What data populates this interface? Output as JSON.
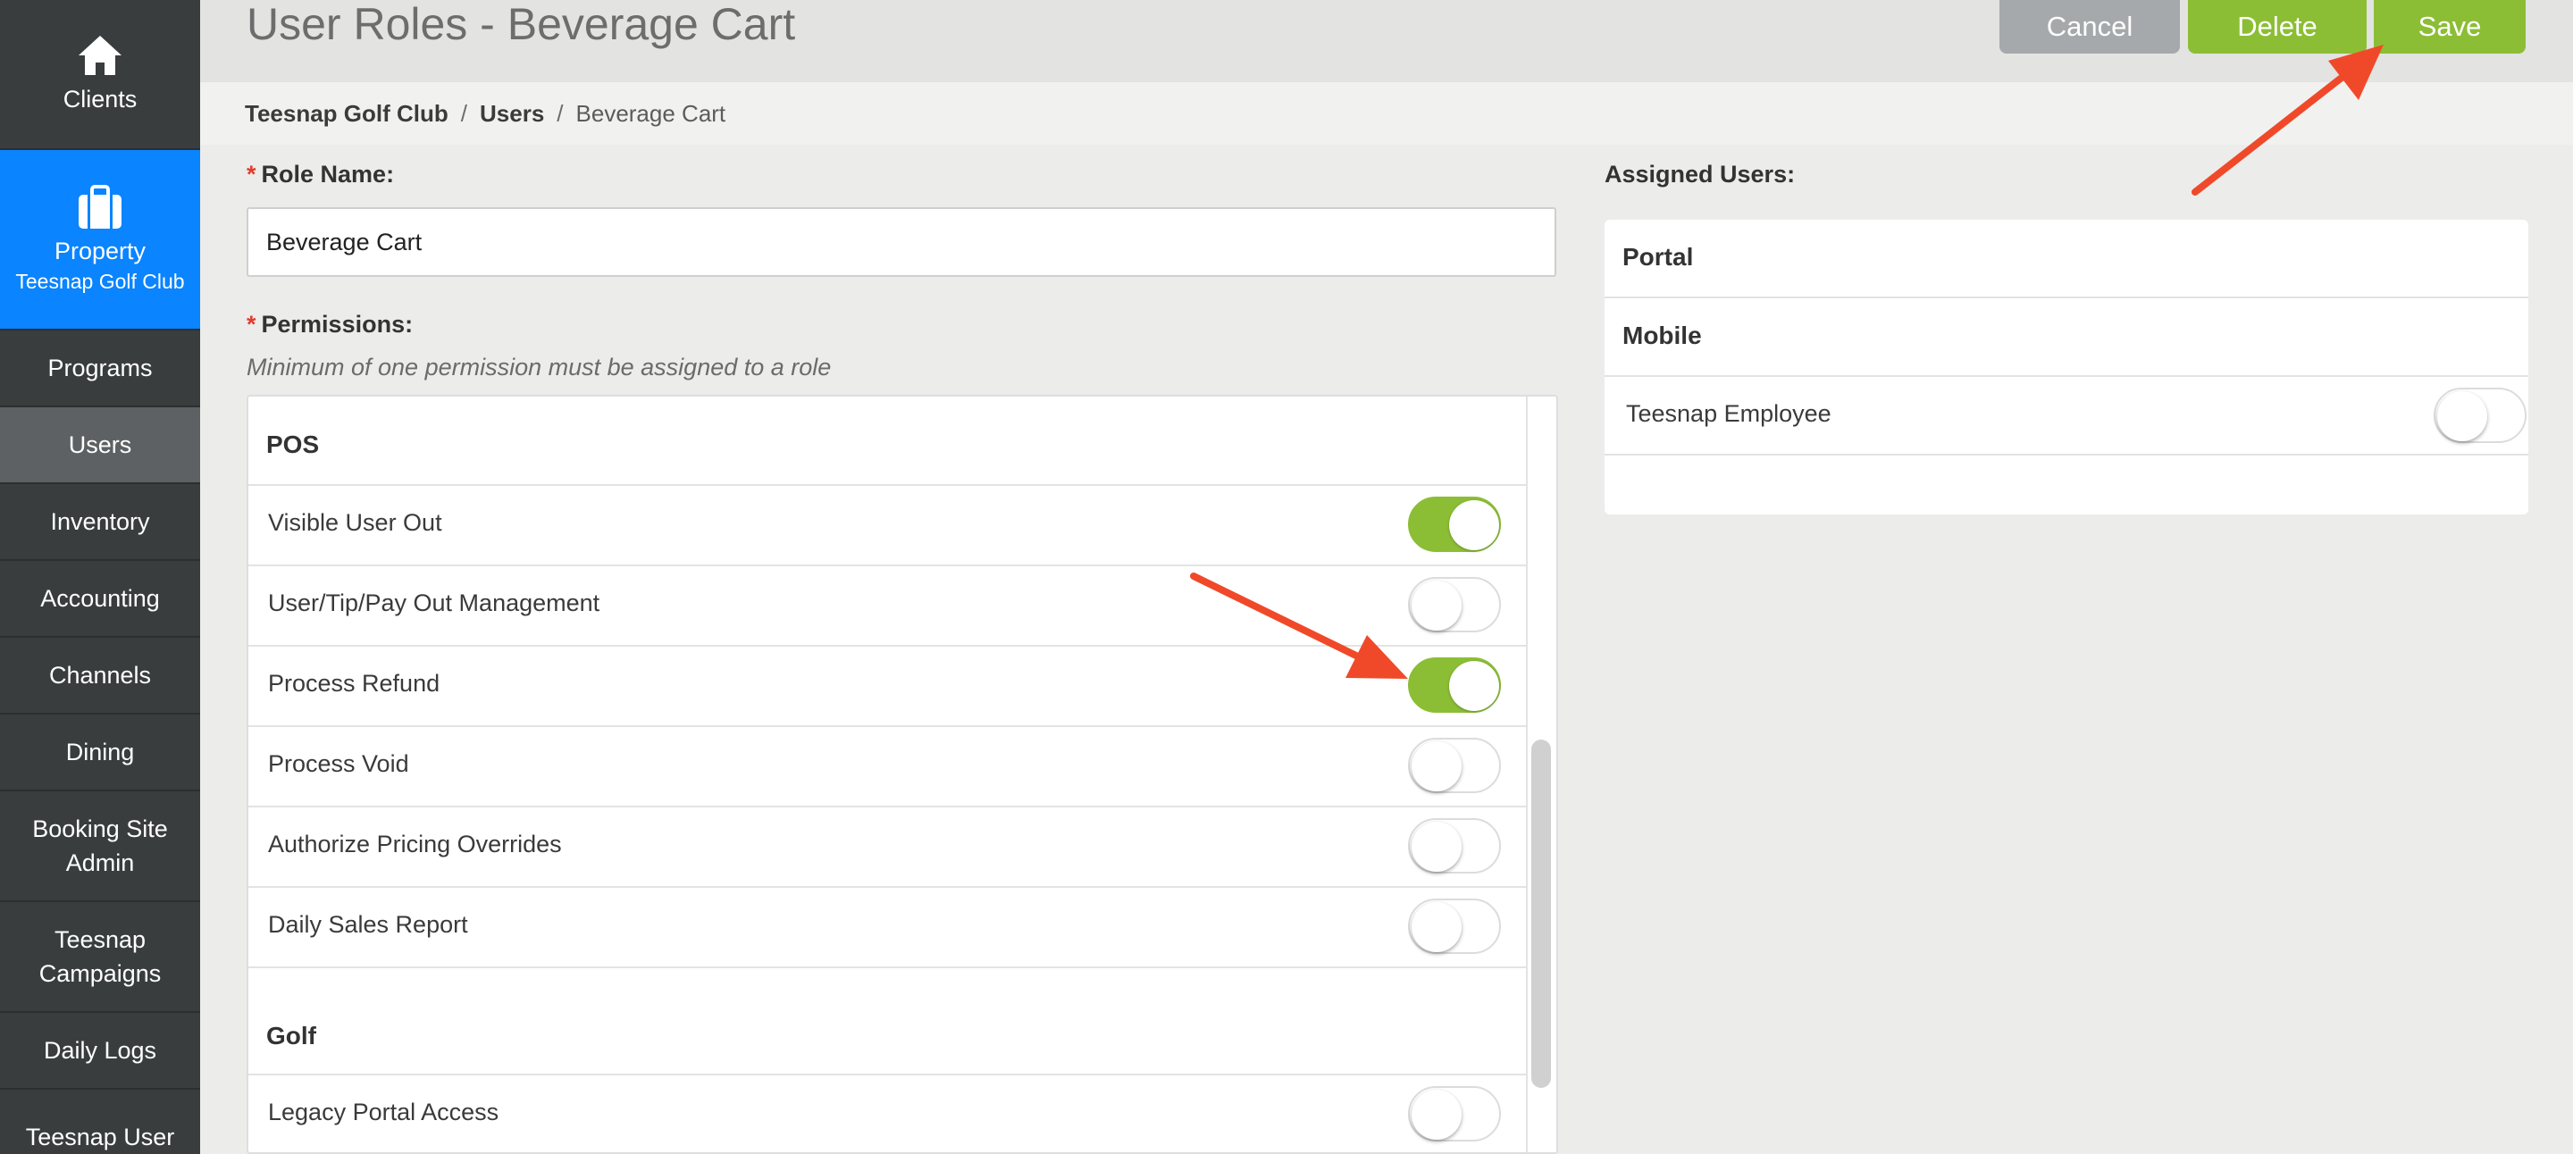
{
  "sidebar": {
    "items": [
      {
        "label": "Clients",
        "icon": "home-icon"
      },
      {
        "label": "Property",
        "sub": "Teesnap Golf Club",
        "icon": "briefcase-icon"
      },
      {
        "label": "Programs"
      },
      {
        "label": "Users"
      },
      {
        "label": "Inventory"
      },
      {
        "label": "Accounting"
      },
      {
        "label": "Channels"
      },
      {
        "label": "Dining"
      },
      {
        "label": "Booking Site",
        "label2": "Admin"
      },
      {
        "label": "Teesnap",
        "label2": "Campaigns"
      },
      {
        "label": "Daily Logs"
      },
      {
        "label": "Teesnap User"
      }
    ],
    "active_blue": "#0a84ff",
    "active_gray": "#5e6163"
  },
  "header": {
    "title": "User Roles - Beverage Cart",
    "cancel_label": "Cancel",
    "delete_label": "Delete",
    "save_label": "Save"
  },
  "breadcrumb": {
    "items": [
      "Teesnap Golf Club",
      "Users",
      "Beverage Cart"
    ],
    "separator": "/"
  },
  "form": {
    "role_name_label": "Role Name:",
    "role_name_value": "Beverage Cart",
    "required_mark": "*",
    "permissions_label": "Permissions:",
    "permissions_hint": "Minimum of one permission must be assigned to a role"
  },
  "permissions": {
    "sections": [
      {
        "title": "POS",
        "items": [
          {
            "label": "Visible User Out",
            "enabled": true
          },
          {
            "label": "User/Tip/Pay Out Management",
            "enabled": false
          },
          {
            "label": "Process Refund",
            "enabled": true
          },
          {
            "label": "Process Void",
            "enabled": false
          },
          {
            "label": "Authorize Pricing Overrides",
            "enabled": false
          },
          {
            "label": "Daily Sales Report",
            "enabled": false
          }
        ]
      },
      {
        "title": "Golf",
        "items": [
          {
            "label": "Legacy Portal Access",
            "enabled": false
          }
        ]
      }
    ]
  },
  "assigned_users": {
    "label": "Assigned Users:",
    "groups": [
      "Portal",
      "Mobile"
    ],
    "users": [
      {
        "name": "Teesnap Employee",
        "assigned": false
      }
    ]
  },
  "colors": {
    "accent_green": "#8cbe35",
    "annotation_arrow": "#f0492a"
  }
}
